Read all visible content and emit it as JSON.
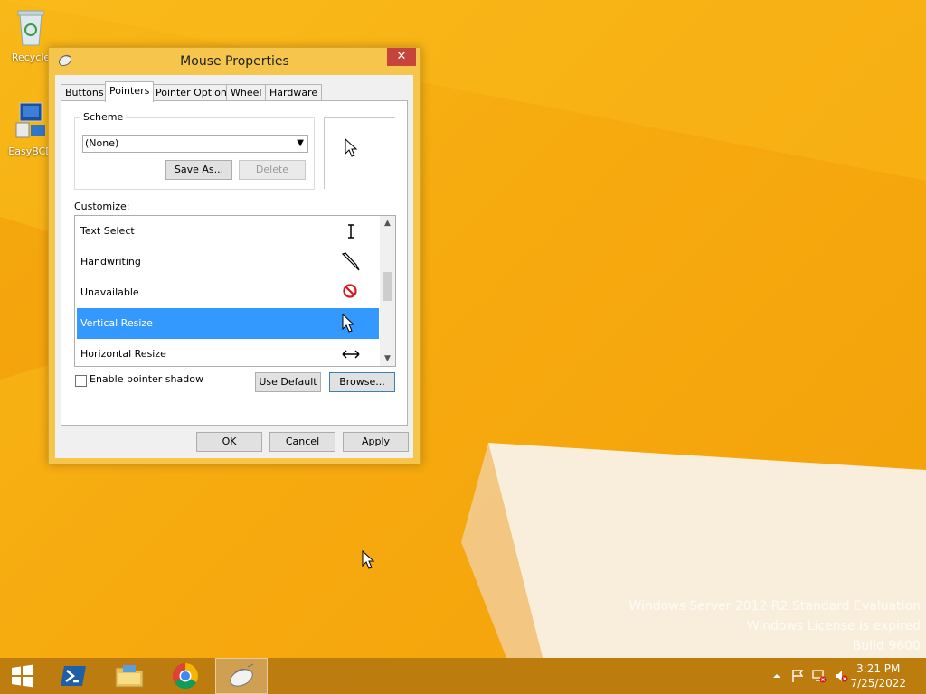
{
  "desktop": {
    "icons": [
      {
        "label": "Recycle",
        "icon": "recycle-bin-icon"
      },
      {
        "label": "EasyBCD",
        "icon": "easybcd-icon"
      }
    ],
    "watermark": [
      "Windows Server 2012 R2 Standard Evaluation",
      "Windows License is expired",
      "Build 9600"
    ]
  },
  "dialog": {
    "title": "Mouse Properties",
    "close_glyph": "✕",
    "tabs": [
      "Buttons",
      "Pointers",
      "Pointer Options",
      "Wheel",
      "Hardware"
    ],
    "active_tab": "Pointers",
    "scheme": {
      "label": "Scheme",
      "value": "(None)",
      "save_as": "Save As...",
      "delete": "Delete"
    },
    "customize": {
      "label": "Customize:",
      "items": [
        {
          "label": "Text Select",
          "cursor": "text-select-icon",
          "selected": false
        },
        {
          "label": "Handwriting",
          "cursor": "handwriting-icon",
          "selected": false
        },
        {
          "label": "Unavailable",
          "cursor": "unavailable-icon",
          "selected": false
        },
        {
          "label": "Vertical Resize",
          "cursor": "arrow-cursor-icon",
          "selected": true
        },
        {
          "label": "Horizontal Resize",
          "cursor": "horizontal-resize-icon",
          "selected": false
        }
      ]
    },
    "shadow_checkbox": {
      "label": "Enable pointer shadow",
      "checked": false
    },
    "use_default": "Use Default",
    "browse": "Browse...",
    "ok": "OK",
    "cancel": "Cancel",
    "apply": "Apply"
  },
  "taskbar": {
    "items": [
      "start-icon",
      "powershell-icon",
      "file-explorer-icon",
      "chrome-icon",
      "mouse-properties-icon"
    ],
    "active_item": "mouse-properties-icon",
    "tray_icons": [
      "show-hidden-icons-icon",
      "action-center-flag-icon",
      "network-icon",
      "volume-muted-icon"
    ],
    "time": "3:21 PM",
    "date": "7/25/2022"
  },
  "colors": {
    "desktop_bg": "#f6aa0e",
    "selection": "#3399ff",
    "close_button": "#c7443a",
    "taskbar": "#b7780f"
  }
}
